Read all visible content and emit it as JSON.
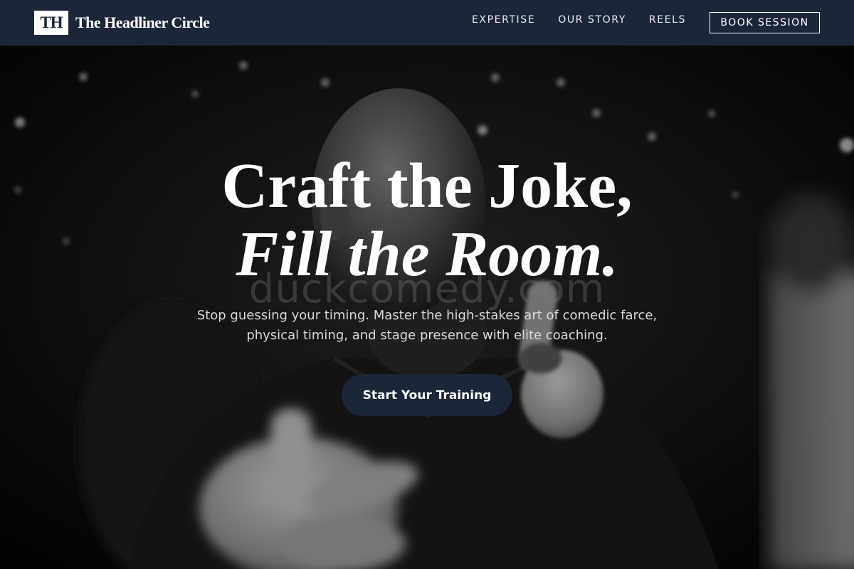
{
  "nav": {
    "logo_mark": "TH",
    "brand_name": "The Headliner Circle",
    "links": [
      "EXPERTISE",
      "OUR STORY",
      "REELS"
    ],
    "book_label": "BOOK SESSION"
  },
  "hero": {
    "watermark": "duckcomedy.com",
    "headline_line1": "Craft the Joke,",
    "headline_line2": "Fill the Room.",
    "subtext": "Stop guessing your timing. Master the high-stakes art of comedic farce, physical timing, and stage presence with elite coaching.",
    "cta_label": "Start Your Training"
  },
  "colors": {
    "nav_bg": "#1c2639",
    "cta_bg": "#1c2639",
    "text": "#ffffff"
  }
}
